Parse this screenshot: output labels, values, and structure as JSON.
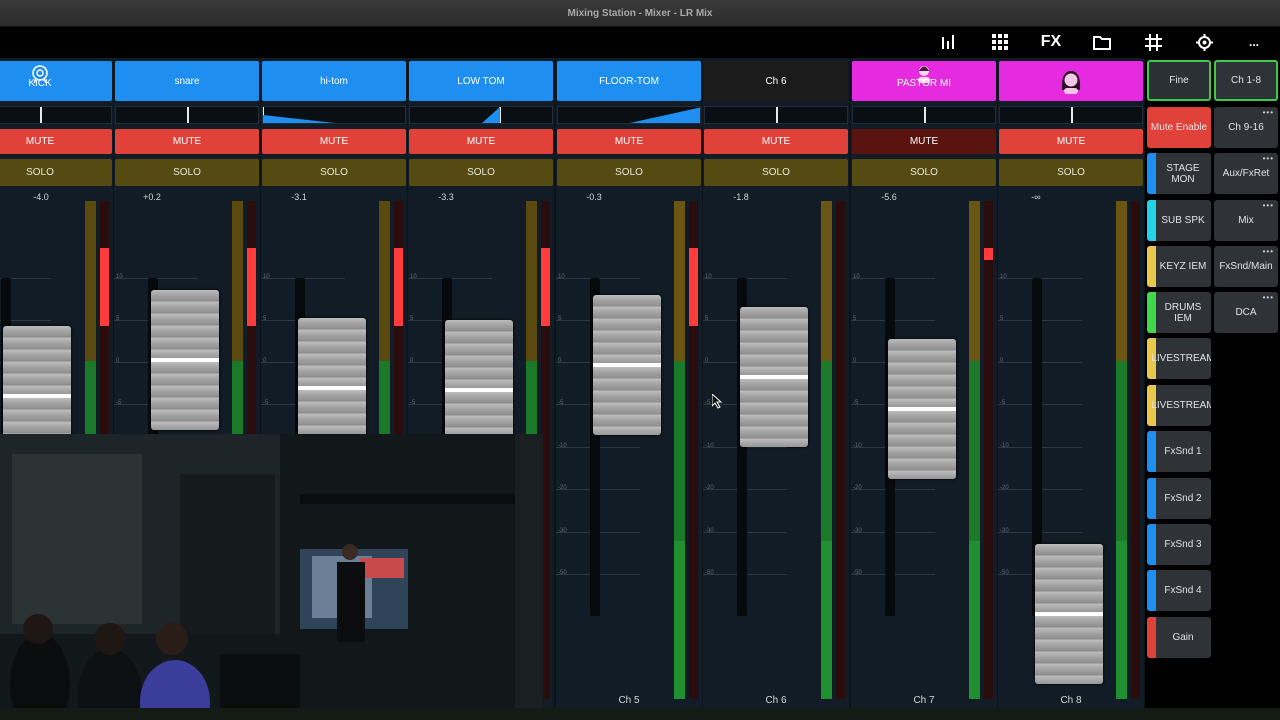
{
  "window": {
    "title": "Mixing Station - Mixer - LR Mix"
  },
  "toolbar": {
    "icons": [
      "meters-icon",
      "grid-icon",
      "fx-label",
      "folder-icon",
      "routing-grid-icon",
      "settings-icon",
      "more-icon"
    ],
    "fx_label": "FX",
    "more_label": "..."
  },
  "channels": [
    {
      "name": "KICK",
      "color": "#1e8ef0",
      "icon": "kick-drum-icon",
      "mute": "MUTE",
      "mute_active": true,
      "solo": "SOLO",
      "level": "-4.0",
      "fader_db": -4.0,
      "pan": 0
    },
    {
      "name": "snare",
      "color": "#1e8ef0",
      "icon": "",
      "mute": "MUTE",
      "mute_active": true,
      "solo": "SOLO",
      "level": "+0.2",
      "fader_db": 0.2,
      "pan": 0
    },
    {
      "name": "hi-tom",
      "color": "#1e8ef0",
      "icon": "",
      "mute": "MUTE",
      "mute_active": true,
      "solo": "SOLO",
      "level": "-3.1",
      "fader_db": -3.1,
      "pan": -100
    },
    {
      "name": "LOW TOM",
      "color": "#1e8ef0",
      "icon": "",
      "mute": "MUTE",
      "mute_active": true,
      "solo": "SOLO",
      "level": "-3.3",
      "fader_db": -3.3,
      "pan": 25
    },
    {
      "name": "FLOOR-TOM",
      "color": "#1e8ef0",
      "icon": "",
      "mute": "MUTE",
      "mute_active": true,
      "solo": "SOLO",
      "level": "-0.3",
      "fader_db": -0.3,
      "pan": 100,
      "label": "Ch 5"
    },
    {
      "name": "Ch 6",
      "color": "#1b1b1b",
      "icon": "",
      "mute": "MUTE",
      "mute_active": true,
      "solo": "SOLO",
      "level": "-1.8",
      "fader_db": -1.8,
      "pan": 0,
      "label": "Ch 6"
    },
    {
      "name": "PASTOR MI",
      "color": "#e52ae0",
      "icon": "person-icon",
      "mute": "MUTE",
      "mute_active": false,
      "solo": "SOLO",
      "level": "-5.6",
      "fader_db": -5.6,
      "pan": 0,
      "label": "Ch 7"
    },
    {
      "name": "",
      "color": "#e52ae0",
      "icon": "woman-icon",
      "mute": "MUTE",
      "mute_active": true,
      "solo": "SOLO",
      "level": "-∞",
      "fader_db": -60,
      "pan": 0,
      "label": "Ch 8"
    }
  ],
  "fader_scale": [
    "10",
    "5",
    "0",
    "-5",
    "-10",
    "-20",
    "-30",
    "-50"
  ],
  "side_panel": {
    "col1": [
      {
        "label": "Fine",
        "color": "",
        "selected": true
      },
      {
        "label": "Mute Enable",
        "color": "#e0423a"
      },
      {
        "label": "STAGE MON",
        "color": "#1e8ef0"
      },
      {
        "label": "SUB SPK",
        "color": "#22d3e6"
      },
      {
        "label": "KEYZ IEM",
        "color": "#e8c84a"
      },
      {
        "label": "DRUMS IEM",
        "color": "#3fd94a"
      },
      {
        "label": "LIVESTREAM",
        "color": "#e8c84a"
      },
      {
        "label": "LIVESTREAM",
        "color": "#e8c84a"
      },
      {
        "label": "FxSnd 1",
        "color": "#1e8ef0"
      },
      {
        "label": "FxSnd 2",
        "color": "#1e8ef0"
      },
      {
        "label": "FxSnd 3",
        "color": "#1e8ef0"
      },
      {
        "label": "FxSnd 4",
        "color": "#1e8ef0"
      },
      {
        "label": "Gain",
        "color": "#e0423a"
      }
    ],
    "col2": [
      {
        "label": "Ch 1-8",
        "selected": true
      },
      {
        "label": "Ch 9-16"
      },
      {
        "label": "Aux/FxRet"
      },
      {
        "label": "Mix"
      },
      {
        "label": "FxSnd/Main"
      },
      {
        "label": "DCA"
      }
    ]
  },
  "colors": {
    "mute_on": "#e0423a",
    "mute_off": "#5a1410",
    "solo": "#544a12",
    "accent_selected": "#3fc94a"
  }
}
